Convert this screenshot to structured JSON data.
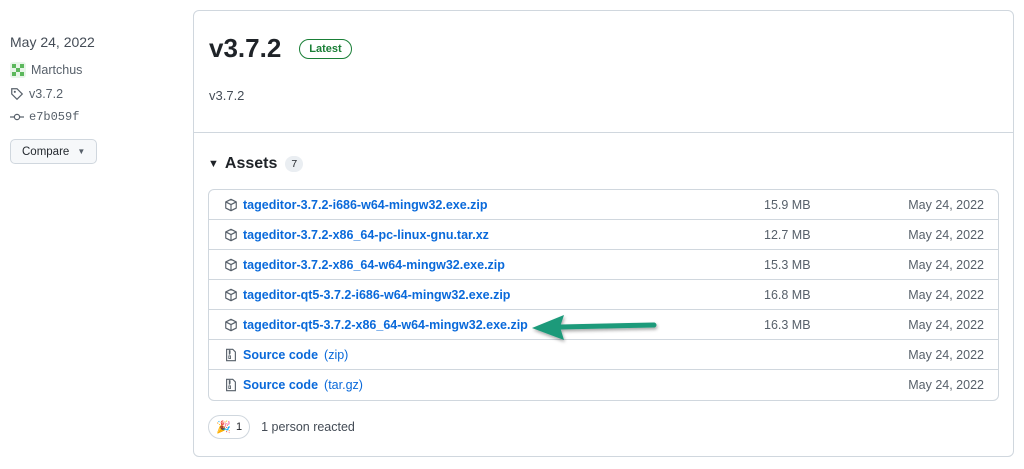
{
  "meta": {
    "date": "May 24, 2022",
    "author": "Martchus",
    "tag": "v3.7.2",
    "commit": "e7b059f",
    "compare_label": "Compare"
  },
  "release": {
    "title": "v3.7.2",
    "badge": "Latest",
    "body": "v3.7.2"
  },
  "assets": {
    "title": "Assets",
    "count": "7",
    "items": [
      {
        "name": "tageditor-3.7.2-i686-w64-mingw32.exe.zip",
        "suffix": "",
        "size": "15.9 MB",
        "date": "May 24, 2022",
        "icon": "package-icon"
      },
      {
        "name": "tageditor-3.7.2-x86_64-pc-linux-gnu.tar.xz",
        "suffix": "",
        "size": "12.7 MB",
        "date": "May 24, 2022",
        "icon": "package-icon"
      },
      {
        "name": "tageditor-3.7.2-x86_64-w64-mingw32.exe.zip",
        "suffix": "",
        "size": "15.3 MB",
        "date": "May 24, 2022",
        "icon": "package-icon"
      },
      {
        "name": "tageditor-qt5-3.7.2-i686-w64-mingw32.exe.zip",
        "suffix": "",
        "size": "16.8 MB",
        "date": "May 24, 2022",
        "icon": "package-icon"
      },
      {
        "name": "tageditor-qt5-3.7.2-x86_64-w64-mingw32.exe.zip",
        "suffix": "",
        "size": "16.3 MB",
        "date": "May 24, 2022",
        "icon": "package-icon"
      },
      {
        "name": "Source code",
        "suffix": "(zip)",
        "size": "",
        "date": "May 24, 2022",
        "icon": "file-zip-icon"
      },
      {
        "name": "Source code",
        "suffix": "(tar.gz)",
        "size": "",
        "date": "May 24, 2022",
        "icon": "file-zip-icon"
      }
    ]
  },
  "reactions": {
    "emoji": "🎉",
    "count": "1",
    "text": "1 person reacted"
  },
  "colors": {
    "link": "#0969da",
    "latest": "#1a7f37",
    "arrow": "#1a9a7a"
  }
}
